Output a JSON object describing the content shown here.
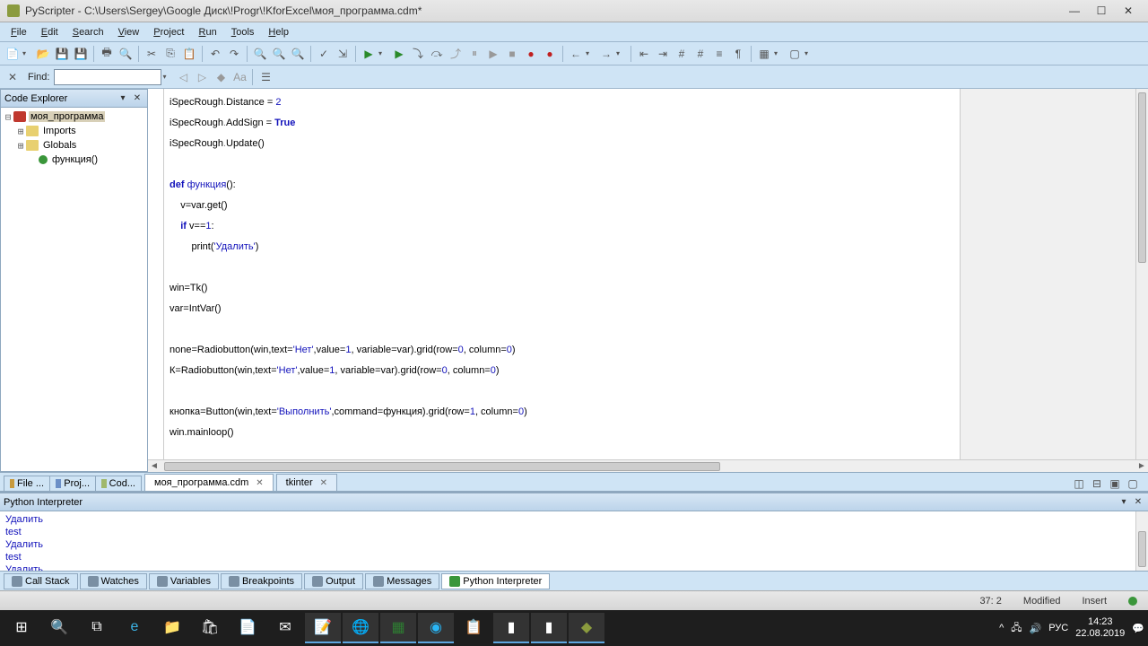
{
  "title": "PyScripter - C:\\Users\\Sergey\\Google Диск\\!Progr\\!KforExcel\\моя_программа.cdm*",
  "menu": {
    "file": "File",
    "edit": "Edit",
    "search": "Search",
    "view": "View",
    "project": "Project",
    "run": "Run",
    "tools": "Tools",
    "help": "Help"
  },
  "find_label": "Find:",
  "code_explorer": {
    "title": "Code Explorer",
    "root": "моя_программа",
    "imports": "Imports",
    "globals": "Globals",
    "func": "функция()"
  },
  "left_tabs": {
    "file": "File ...",
    "proj": "Proj...",
    "cod": "Cod..."
  },
  "editor_tabs": {
    "main": "моя_программа.cdm",
    "tk": "tkinter"
  },
  "code": {
    "l1a": "iSpecRough",
    "l1b": "Distance",
    "l1c": " = ",
    "l1d": "2",
    "l2a": "iSpecRough",
    "l2b": "AddSign",
    "l2c": " = ",
    "l2d": "True",
    "l3a": "iSpecRough",
    "l3b": "Update()",
    "l5a": "def ",
    "l5b": "функция",
    "l5c": "():",
    "l6": "    v=var.get()",
    "l7a": "    ",
    "l7b": "if",
    "l7c": " v==",
    "l7d": "1",
    "l7e": ":",
    "l8a": "        print(",
    "l8b": "'Удалить'",
    "l8c": ")",
    "l10": "win=Tk()",
    "l11": "var=IntVar()",
    "l13a": "none=Radiobutton(win,text=",
    "l13b": "'Нет'",
    "l13c": ",value=",
    "l13d": "1",
    "l13e": ", variable=var).grid(row=",
    "l13f": "0",
    "l13g": ", column=",
    "l13h": "0",
    "l13i": ")",
    "l14a": "К=Radiobutton(win,text=",
    "l14b": "'Нет'",
    "l14c": ",value=",
    "l14d": "1",
    "l14e": ", variable=var).grid(row=",
    "l14f": "0",
    "l14g": ", column=",
    "l14h": "0",
    "l14i": ")",
    "l16a": "кнопка=Button(win,text=",
    "l16b": "'Выполнить'",
    "l16c": ",command=функция).grid(row=",
    "l16d": "1",
    "l16e": ", column=",
    "l16f": "0",
    "l16g": ")",
    "l17": "win.mainloop()"
  },
  "interpreter": {
    "title": "Python Interpreter",
    "lines": [
      "Удалить",
      "test",
      "Удалить",
      "test",
      "Удалить"
    ],
    "prompt": ">>> "
  },
  "bottom_tabs": {
    "cs": "Call Stack",
    "w": "Watches",
    "v": "Variables",
    "b": "Breakpoints",
    "o": "Output",
    "m": "Messages",
    "pi": "Python Interpreter"
  },
  "status": {
    "pos": "37: 2",
    "mod": "Modified",
    "ins": "Insert"
  },
  "clock": {
    "time": "14:23",
    "date": "22.08.2019"
  }
}
